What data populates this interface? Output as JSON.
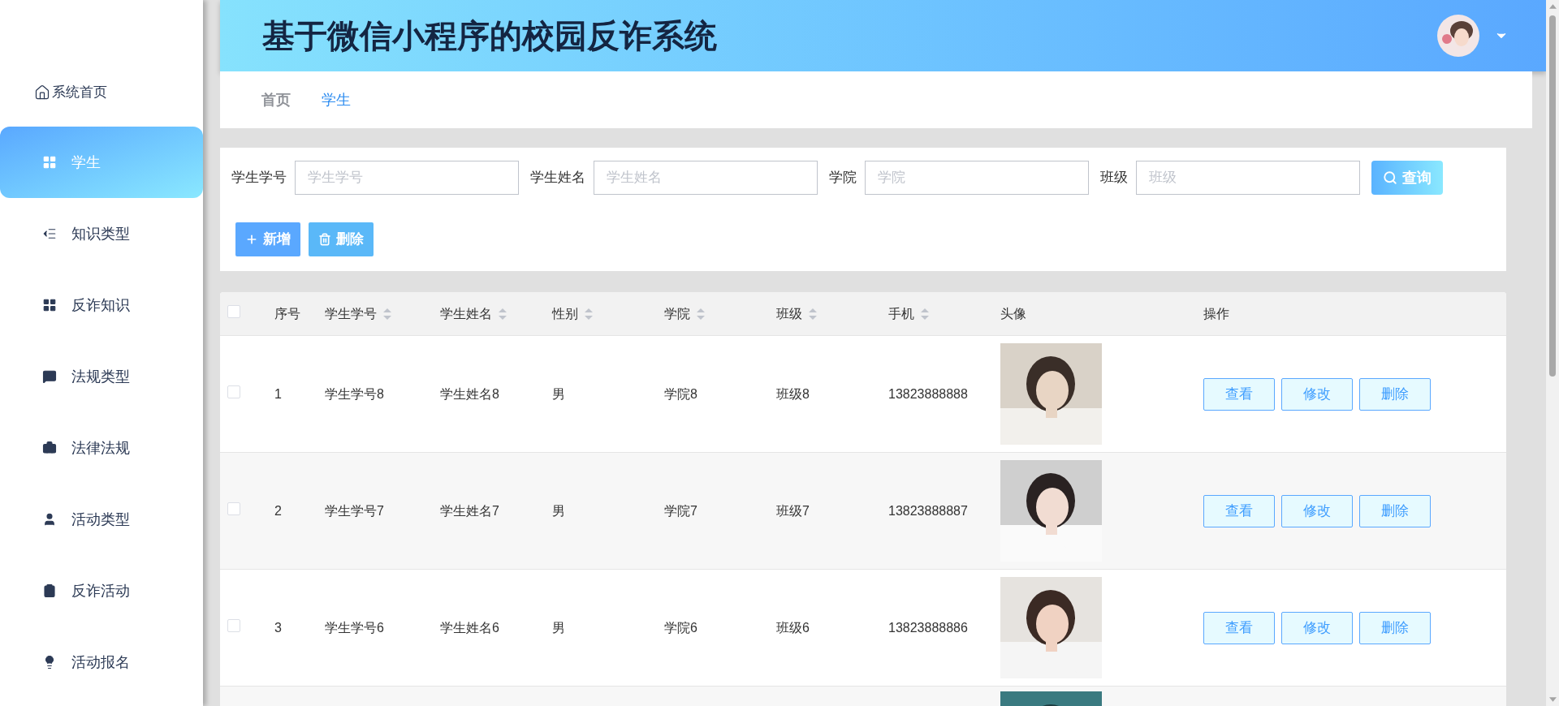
{
  "sidebar": {
    "home": "系统首页",
    "items": [
      {
        "label": "学生",
        "selected": true
      },
      {
        "label": "知识类型",
        "selected": false
      },
      {
        "label": "反诈知识",
        "selected": false
      },
      {
        "label": "法规类型",
        "selected": false
      },
      {
        "label": "法律法规",
        "selected": false
      },
      {
        "label": "活动类型",
        "selected": false
      },
      {
        "label": "反诈活动",
        "selected": false
      },
      {
        "label": "活动报名",
        "selected": false
      }
    ]
  },
  "header": {
    "title": "基于微信小程序的校园反诈系统"
  },
  "breadcrumb": [
    {
      "label": "首页",
      "selected": false
    },
    {
      "label": "学生",
      "selected": true
    }
  ],
  "search": {
    "fields": [
      {
        "label": "学生学号",
        "placeholder": "学生学号"
      },
      {
        "label": "学生姓名",
        "placeholder": "学生姓名"
      },
      {
        "label": "学院",
        "placeholder": "学院"
      },
      {
        "label": "班级",
        "placeholder": "班级"
      }
    ],
    "query_button": "查询"
  },
  "actions": [
    {
      "kind": "add",
      "label": "新增"
    },
    {
      "kind": "delete",
      "label": "删除"
    }
  ],
  "table": {
    "select_all": {
      "checked": false
    },
    "columns": [
      {
        "label": "序号",
        "sortable": false
      },
      {
        "label": "学生学号",
        "sortable": true
      },
      {
        "label": "学生姓名",
        "sortable": true
      },
      {
        "label": "性别",
        "sortable": true
      },
      {
        "label": "学院",
        "sortable": true
      },
      {
        "label": "班级",
        "sortable": true
      },
      {
        "label": "手机",
        "sortable": true
      },
      {
        "label": "头像",
        "sortable": false
      },
      {
        "label": "操作",
        "sortable": false
      }
    ],
    "rows": [
      {
        "checked": false,
        "cells": [
          "1",
          "学生学号8",
          "学生姓名8",
          "男",
          "学院8",
          "班级8",
          "13823888888"
        ],
        "avatar": {
          "kind": "picture"
        },
        "buttons": [
          "查看",
          "修改",
          "删除"
        ]
      },
      {
        "checked": false,
        "cells": [
          "2",
          "学生学号7",
          "学生姓名7",
          "男",
          "学院7",
          "班级7",
          "13823888887"
        ],
        "avatar": {
          "kind": "picture"
        },
        "buttons": [
          "查看",
          "修改",
          "删除"
        ]
      },
      {
        "checked": false,
        "cells": [
          "3",
          "学生学号6",
          "学生姓名6",
          "男",
          "学院6",
          "班级6",
          "13823888886"
        ],
        "avatar": {
          "kind": "picture"
        },
        "buttons": [
          "查看",
          "修改",
          "删除"
        ]
      }
    ],
    "partial_row": {
      "avatar": {
        "kind": "picture"
      }
    }
  }
}
